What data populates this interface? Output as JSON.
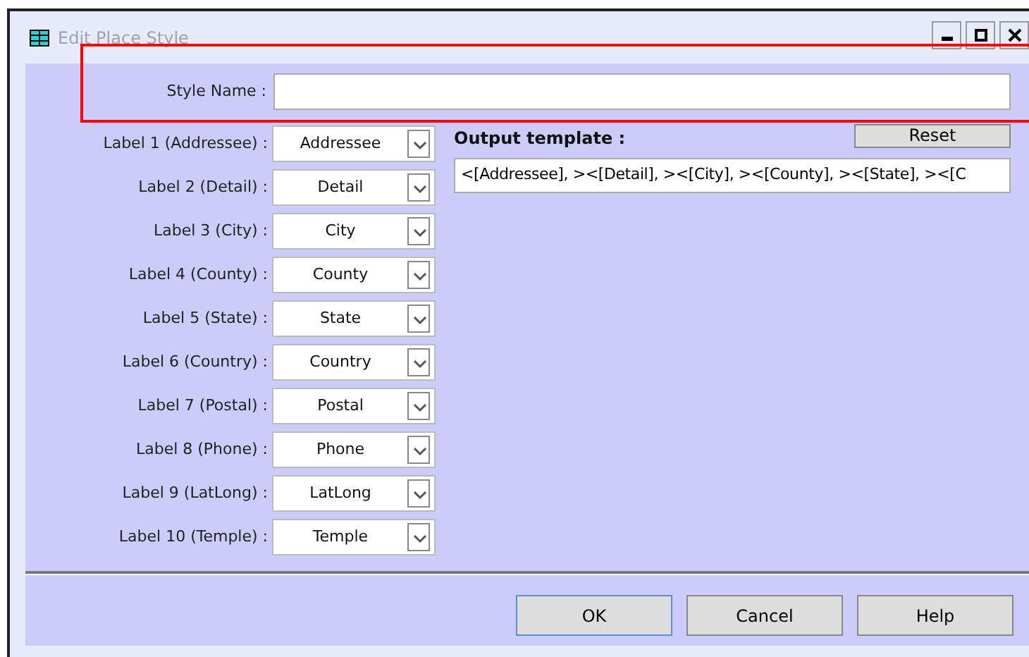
{
  "window": {
    "title": "Edit Place Style"
  },
  "style_name": {
    "label": "Style Name :"
  },
  "labels": [
    {
      "label": "Label 1 (Addressee) :",
      "value": "Addressee"
    },
    {
      "label": "Label 2 (Detail) :",
      "value": "Detail"
    },
    {
      "label": "Label 3 (City) :",
      "value": "City"
    },
    {
      "label": "Label 4 (County) :",
      "value": "County"
    },
    {
      "label": "Label 5 (State) :",
      "value": "State"
    },
    {
      "label": "Label 6 (Country) :",
      "value": "Country"
    },
    {
      "label": "Label 7 (Postal) :",
      "value": "Postal"
    },
    {
      "label": "Label 8 (Phone) :",
      "value": "Phone"
    },
    {
      "label": "Label 9 (LatLong) :",
      "value": "LatLong"
    },
    {
      "label": "Label 10 (Temple) :",
      "value": "Temple"
    }
  ],
  "output_template": {
    "label": "Output template :",
    "value": "<[Addressee], ><[Detail], ><[City], ><[County], ><[State], ><[C",
    "reset": "Reset"
  },
  "buttons": [
    {
      "label": "OK",
      "default": true
    },
    {
      "label": "Cancel",
      "default": false
    },
    {
      "label": "Help",
      "default": false
    }
  ]
}
